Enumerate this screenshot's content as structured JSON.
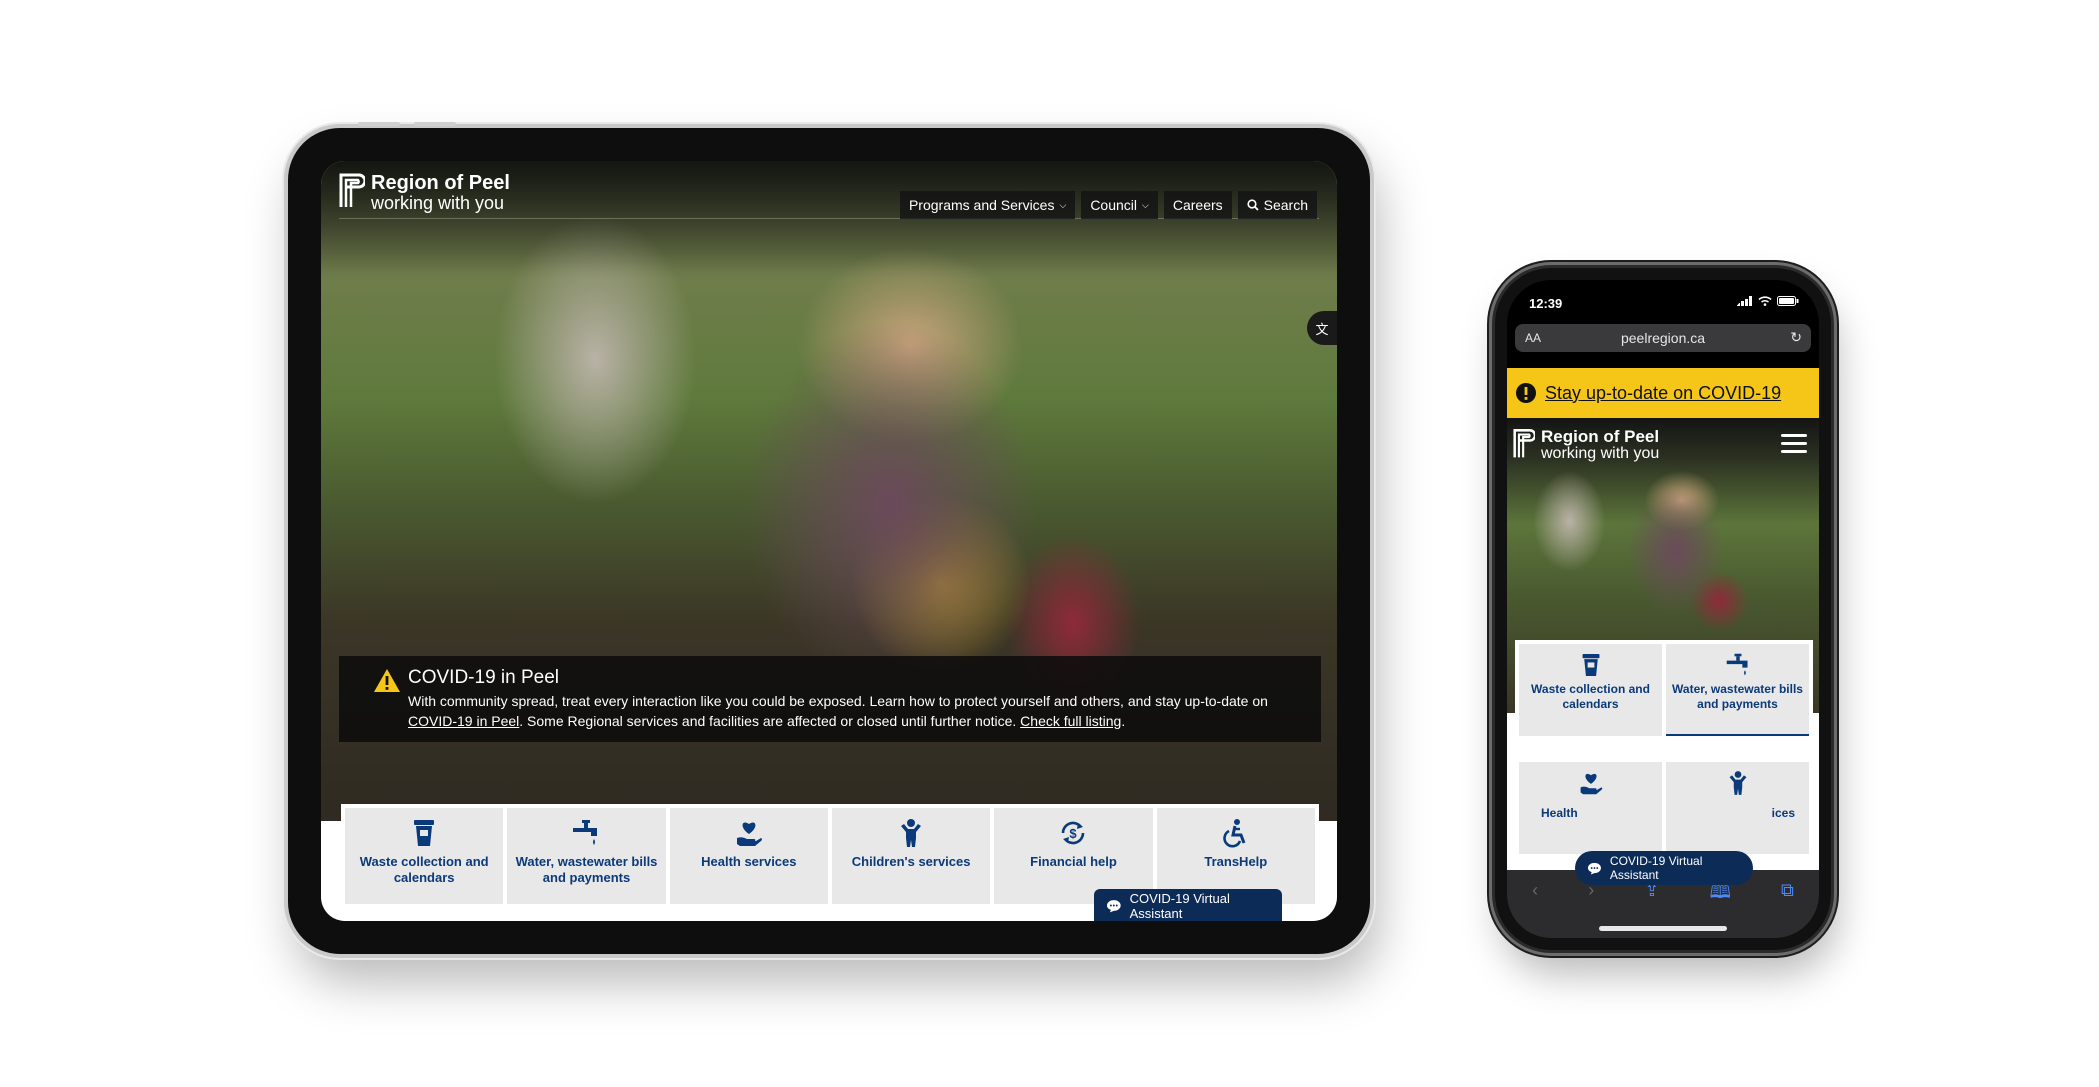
{
  "tablet": {
    "logo": {
      "name": "Region of Peel",
      "tagline": "working with you"
    },
    "nav": [
      {
        "label": "Programs and Services",
        "has_dropdown": true
      },
      {
        "label": "Council",
        "has_dropdown": true
      },
      {
        "label": "Careers",
        "has_dropdown": false
      },
      {
        "label": "Search",
        "icon": "search-icon"
      }
    ],
    "translate_icon": "translate-icon",
    "alert": {
      "icon": "warning-icon",
      "title": "COVID-19 in Peel",
      "body_start": "With community spread, treat every interaction like you could be exposed. Learn how to protect yourself and others, and stay up-to-date on ",
      "link1": "COVID-19 in Peel",
      "body_mid": ". Some Regional services and facilities are affected or closed until further notice. ",
      "link2": "Check full listing",
      "body_end": "."
    },
    "tiles": [
      {
        "icon": "waste-bin-icon",
        "label": "Waste collection and calendars"
      },
      {
        "icon": "water-tap-icon",
        "label": "Water, wastewater bills and payments"
      },
      {
        "icon": "heart-hand-icon",
        "label": "Health services"
      },
      {
        "icon": "child-icon",
        "label": "Children's services"
      },
      {
        "icon": "dollar-cycle-icon",
        "label": "Financial help"
      },
      {
        "icon": "wheelchair-icon",
        "label": "TransHelp"
      }
    ],
    "virtual_assistant": "COVID-19 Virtual Assistant"
  },
  "phone": {
    "status_time": "12:39",
    "url_aa": "AA",
    "url": "peelregion.ca",
    "covid_banner": "Stay up-to-date on COVID-19",
    "logo": {
      "name": "Region of Peel",
      "tagline": "working with you"
    },
    "tiles": [
      {
        "icon": "waste-bin-icon",
        "label": "Waste collection and calendars"
      },
      {
        "icon": "water-tap-icon",
        "label": "Water, wastewater bills and payments"
      },
      {
        "icon": "heart-hand-icon",
        "label": "Health"
      },
      {
        "icon": "child-icon",
        "label": "ices"
      }
    ],
    "virtual_assistant": "COVID-19 Virtual Assistant"
  },
  "colors": {
    "brand_blue": "#0b3a7a",
    "assistant_navy": "#0d2b57",
    "covid_yellow": "#f5c518",
    "tile_gray": "#e8e8e8"
  }
}
